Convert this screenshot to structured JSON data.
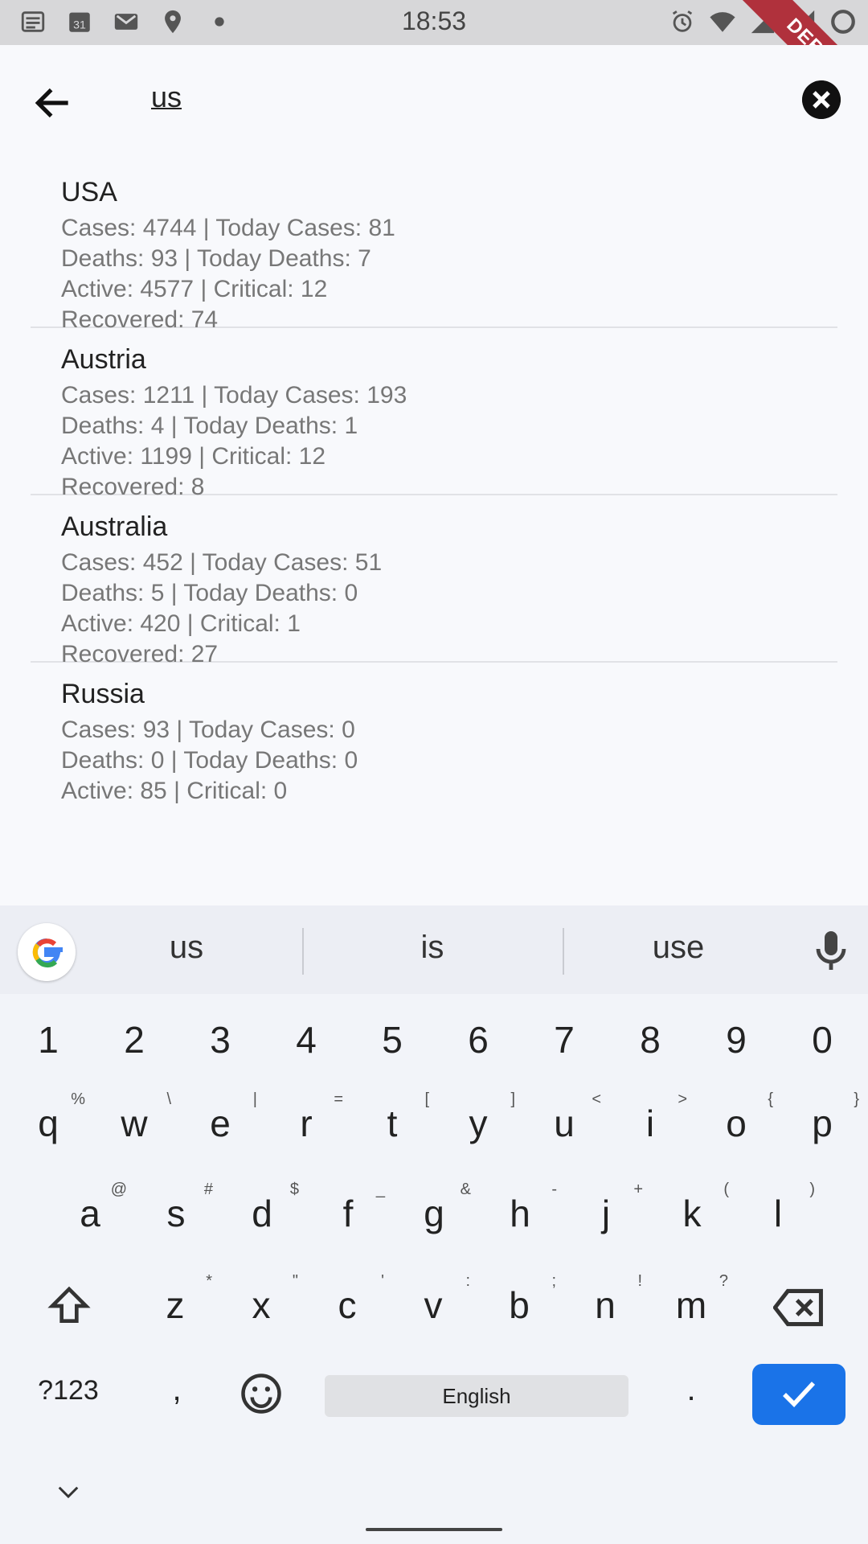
{
  "status_bar": {
    "time": "18:53",
    "debug_label": "DEBUG",
    "icons_left": [
      "news-icon",
      "calendar-icon",
      "gmail-icon",
      "location-icon",
      "dot-icon"
    ],
    "icons_right": [
      "alarm-icon",
      "wifi-icon",
      "signal-icon",
      "signal-icon",
      "battery-icon"
    ]
  },
  "search": {
    "query": "us"
  },
  "results": [
    {
      "country": "USA",
      "line1": "Cases: 4744 | Today Cases: 81",
      "line2": "Deaths: 93 | Today Deaths: 7",
      "line3": "Active: 4577 | Critical: 12",
      "line4": "Recovered: 74"
    },
    {
      "country": "Austria",
      "line1": "Cases: 1211 | Today Cases: 193",
      "line2": "Deaths: 4 | Today Deaths: 1",
      "line3": "Active: 1199 | Critical: 12",
      "line4": "Recovered: 8"
    },
    {
      "country": "Australia",
      "line1": "Cases: 452 | Today Cases: 51",
      "line2": "Deaths: 5 | Today Deaths: 0",
      "line3": "Active: 420 | Critical: 1",
      "line4": "Recovered: 27"
    },
    {
      "country": "Russia",
      "line1": "Cases: 93 | Today Cases: 0",
      "line2": "Deaths: 0 | Today Deaths: 0",
      "line3": "Active: 85 | Critical: 0",
      "line4": ""
    }
  ],
  "keyboard": {
    "suggestions": [
      "us",
      "is",
      "use"
    ],
    "numbers": [
      "1",
      "2",
      "3",
      "4",
      "5",
      "6",
      "7",
      "8",
      "9",
      "0"
    ],
    "row1": [
      [
        "q",
        "%"
      ],
      [
        "w",
        "\\"
      ],
      [
        "e",
        "|"
      ],
      [
        "r",
        "="
      ],
      [
        "t",
        "["
      ],
      [
        "y",
        "]"
      ],
      [
        "u",
        "<"
      ],
      [
        "i",
        ">"
      ],
      [
        "o",
        "{"
      ],
      [
        "p",
        "}"
      ]
    ],
    "row2": [
      [
        "a",
        "@"
      ],
      [
        "s",
        "#"
      ],
      [
        "d",
        "$"
      ],
      [
        "f",
        "_"
      ],
      [
        "g",
        "&"
      ],
      [
        "h",
        "-"
      ],
      [
        "j",
        "+"
      ],
      [
        "k",
        "("
      ],
      [
        "l",
        ")"
      ]
    ],
    "row3": [
      [
        "z",
        "*"
      ],
      [
        "x",
        "\""
      ],
      [
        "c",
        "'"
      ],
      [
        "v",
        ":"
      ],
      [
        "b",
        ";"
      ],
      [
        "n",
        "!"
      ],
      [
        "m",
        "?"
      ]
    ],
    "symbols_key": "?123",
    "comma_key": ",",
    "period_key": ".",
    "space_label": "English",
    "accent_color": "#1a73e8"
  }
}
